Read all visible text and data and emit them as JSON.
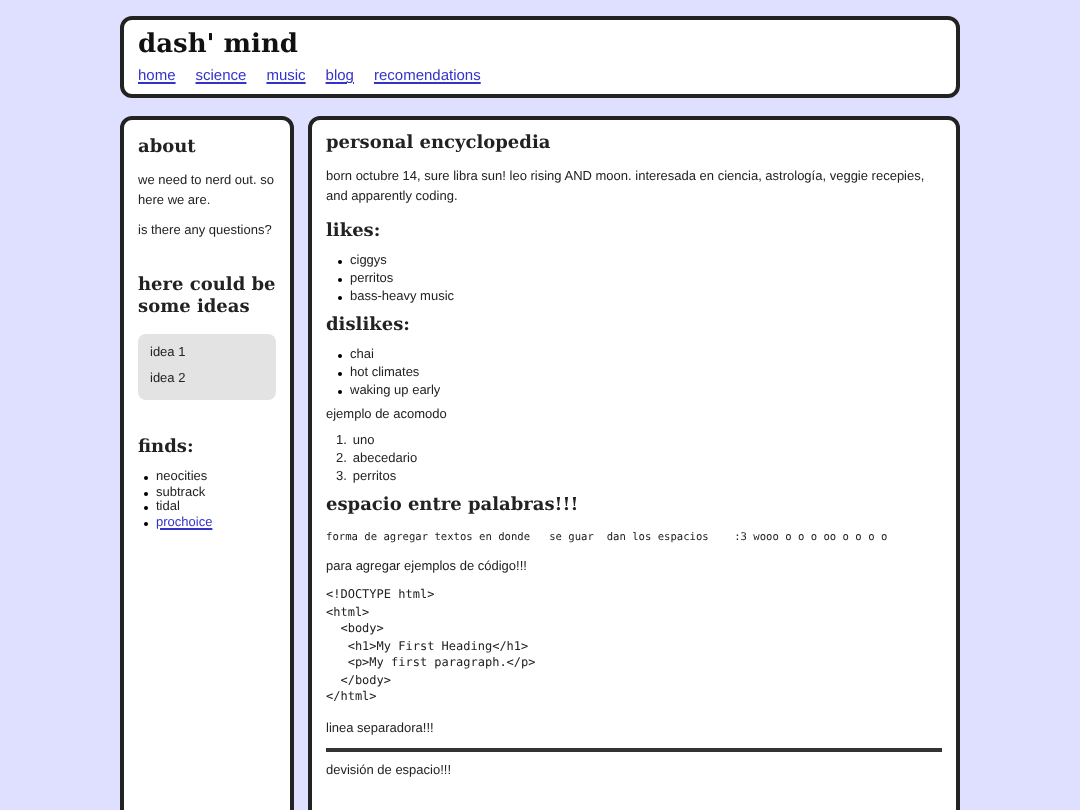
{
  "header": {
    "title": "dash' mind",
    "nav": [
      "home",
      "science",
      "music",
      "blog",
      "recomendations"
    ]
  },
  "sidebar": {
    "about": {
      "heading": "about",
      "paragraphs": [
        "we need to nerd out. so here we are.",
        "is there any questions?"
      ]
    },
    "ideas": {
      "heading": "here could be some ideas",
      "items": [
        "idea 1",
        "idea 2"
      ]
    },
    "finds": {
      "heading": "finds:",
      "items": [
        {
          "text": "neocities",
          "kind": "text"
        },
        {
          "text": "subtrack",
          "kind": "text"
        },
        {
          "text": "tidal",
          "kind": "text"
        },
        {
          "text": "prochoice",
          "kind": "link"
        }
      ]
    }
  },
  "main": {
    "title": "personal encyclopedia",
    "bio": "born octubre 14, sure libra sun! leo rising AND moon. interesada en ciencia, astrología, veggie recepies, and apparently coding.",
    "likes": {
      "heading": "likes:",
      "items": [
        "ciggys",
        "perritos",
        "bass-heavy music"
      ]
    },
    "dislikes": {
      "heading": "dislikes:",
      "items": [
        "chai",
        "hot climates",
        "waking up early"
      ]
    },
    "ordered": {
      "label": "ejemplo de acomodo",
      "items": [
        {
          "number": "1.",
          "text": "uno"
        },
        {
          "number": "2.",
          "text": "abecedario"
        },
        {
          "number": "3.",
          "text": "perritos"
        }
      ]
    },
    "spacing": {
      "heading": "espacio entre palabras!!!",
      "pre": "forma de agregar textos en donde   se guar  dan los espacios    :3 wooo o o o oo o o o o"
    },
    "code_label": "para agregar ejemplos de código!!!",
    "code": "<!DOCTYPE html>\n<html>\n  <body>\n   <h1>My First Heading</h1>\n   <p>My first paragraph.</p>\n  </body>\n</html>",
    "separator_label": "linea separadora!!!",
    "division_label": "devisión de espacio!!!"
  }
}
